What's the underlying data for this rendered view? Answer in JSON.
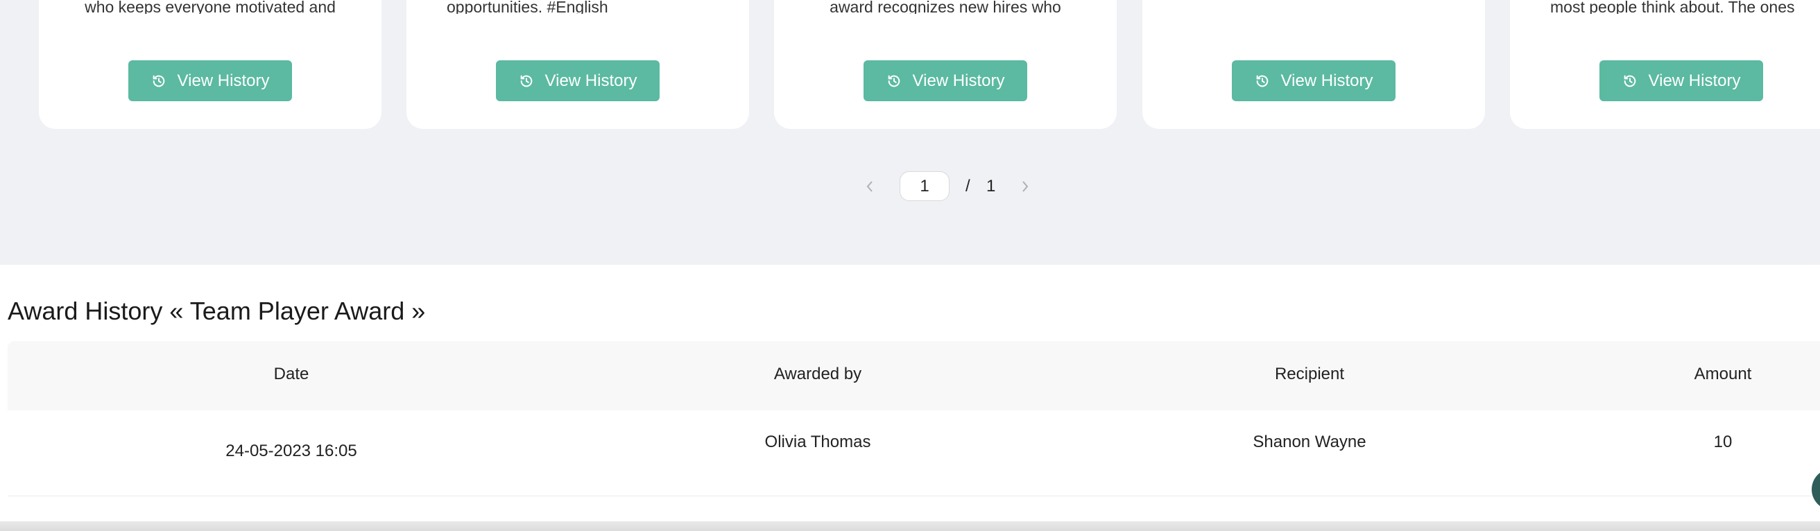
{
  "cards": [
    {
      "text": "who keeps everyone motivated and",
      "button_label": "View History"
    },
    {
      "text": "opportunities. #English",
      "button_label": "View History"
    },
    {
      "text": "award recognizes new hires who",
      "button_label": "View History"
    },
    {
      "text": "",
      "button_label": "View History"
    },
    {
      "text": "most people think about. The ones",
      "button_label": "View History"
    }
  ],
  "pagination": {
    "current": "1",
    "separator": "/",
    "total": "1"
  },
  "history": {
    "title": "Award History « Team Player Award »",
    "columns": [
      "Date",
      "Awarded by",
      "Recipient",
      "Amount"
    ],
    "rows": [
      {
        "date": "24-05-2023 16:05",
        "awarded_by": "Olivia Thomas",
        "recipient": "Shanon Wayne",
        "amount": "10"
      }
    ]
  },
  "colors": {
    "accent": "#5bbaa1",
    "page_bg": "#f0f1f5",
    "help_button": "#2f5d5a"
  },
  "icons": {
    "button_icon": "history-clock-icon",
    "prev": "chevron-left-icon",
    "next": "chevron-right-icon"
  }
}
